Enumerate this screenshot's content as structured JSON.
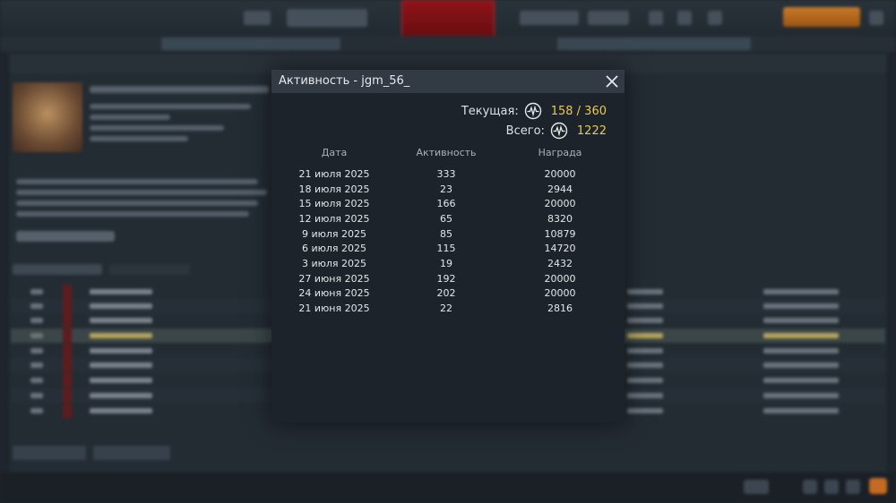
{
  "dialog": {
    "title": "Активность - jgm_56_",
    "current_label": "Текущая:",
    "current_value": "158 / 360",
    "total_label": "Всего:",
    "total_value": "1222",
    "activity_icon": "activity-wave-icon",
    "close_icon": "close-icon"
  },
  "table": {
    "headers": [
      "Дата",
      "Активность",
      "Награда"
    ],
    "rows": [
      [
        "21 июля 2025",
        "333",
        "20000"
      ],
      [
        "18 июля 2025",
        "23",
        "2944"
      ],
      [
        "15 июля 2025",
        "166",
        "20000"
      ],
      [
        "12 июля 2025",
        "65",
        "8320"
      ],
      [
        "9 июля 2025",
        "85",
        "10879"
      ],
      [
        "6 июля 2025",
        "115",
        "14720"
      ],
      [
        "3 июля 2025",
        "19",
        "2432"
      ],
      [
        "27 июня 2025",
        "192",
        "20000"
      ],
      [
        "24 июня 2025",
        "202",
        "20000"
      ],
      [
        "21 июня 2025",
        "22",
        "2816"
      ]
    ]
  },
  "colors": {
    "accent_gold": "#e8c85a",
    "header_bg": "#323b44",
    "modal_bg": "#1c232a"
  }
}
